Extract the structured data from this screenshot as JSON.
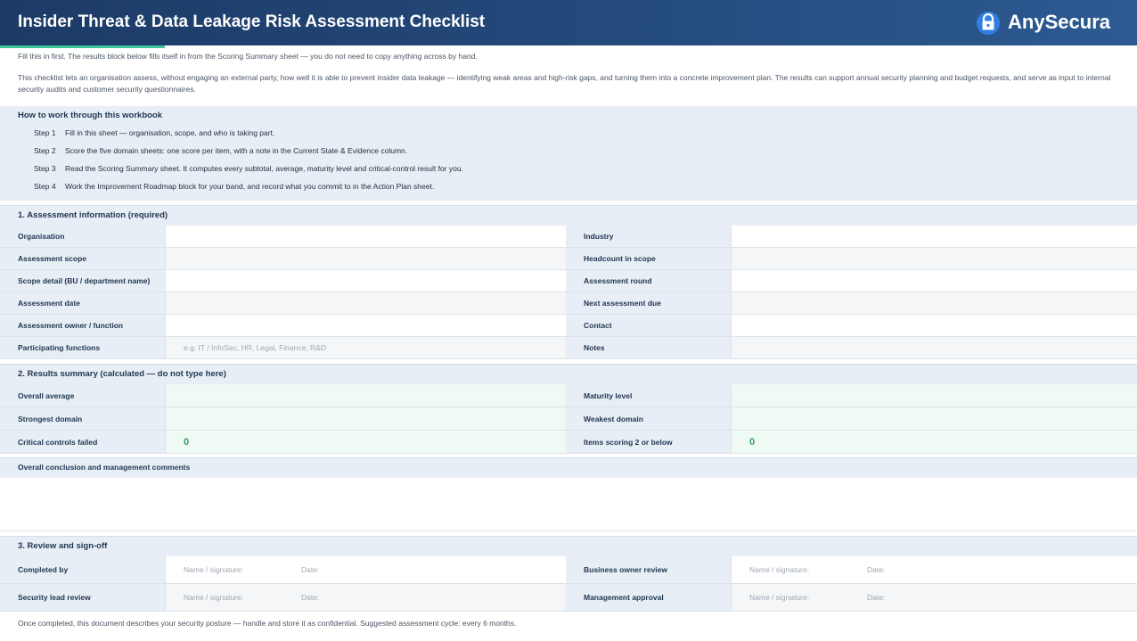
{
  "header": {
    "title": "Insider Threat & Data Leakage Risk Assessment Checklist",
    "brand": "AnySecura",
    "colors": {
      "header_bg": "#1c3a66",
      "accent": "#3fc59a",
      "result_green": "#2e9d6c"
    }
  },
  "intro": {
    "line1": "Fill this in first. The results block below fills itself in from the Scoring Summary sheet — you do not need to copy anything across by hand.",
    "line2": "This checklist lets an organisation assess, without engaging an external party, how well it is able to prevent insider data leakage — identifying weak areas and high-risk gaps, and turning them into a concrete improvement plan. The results can support annual security planning and budget requests, and serve as input to internal security audits and customer security questionnaires."
  },
  "howto": {
    "title": "How to work through this workbook",
    "steps": [
      {
        "num": "Step 1",
        "text": "Fill in this sheet — organisation, scope, and who is taking part."
      },
      {
        "num": "Step 2",
        "text": "Score the five domain sheets: one score per item, with a note in the Current State & Evidence column."
      },
      {
        "num": "Step 3",
        "text": "Read the Scoring Summary sheet. It computes every subtotal, average, maturity level and critical-control result for you."
      },
      {
        "num": "Step 4",
        "text": "Work the Improvement Roadmap block for your band, and record what you commit to in the Action Plan sheet."
      }
    ]
  },
  "section1": {
    "title": "1.  Assessment information  (required)",
    "rows": [
      {
        "l1": "Organisation",
        "v1": "",
        "l2": "Industry",
        "v2": ""
      },
      {
        "l1": "Assessment scope",
        "v1": "",
        "l2": "Headcount in scope",
        "v2": ""
      },
      {
        "l1": "Scope detail (BU / department name)",
        "v1": "",
        "l2": "Assessment round",
        "v2": ""
      },
      {
        "l1": "Assessment date",
        "v1": "",
        "l2": "Next assessment due",
        "v2": ""
      },
      {
        "l1": "Assessment owner / function",
        "v1": "",
        "l2": "Contact",
        "v2": ""
      },
      {
        "l1": "Participating functions",
        "v1": "e.g. IT / InfoSec, HR, Legal, Finance, R&D",
        "l2": "Notes",
        "v2": ""
      }
    ]
  },
  "section2": {
    "title": "2.  Results summary  (calculated — do not type here)",
    "rows": [
      {
        "l1": "Overall average",
        "v1": "",
        "l2": "Maturity level",
        "v2": ""
      },
      {
        "l1": "Strongest domain",
        "v1": "",
        "l2": "Weakest domain",
        "v2": ""
      },
      {
        "l1": "Critical controls failed",
        "v1": "0",
        "l2": "Items scoring 2 or below",
        "v2": "0"
      }
    ],
    "conclusion_label": "Overall conclusion and management comments"
  },
  "section3": {
    "title": "3.  Review and sign-off",
    "name_hint": "Name / signature:",
    "date_hint": "Date:",
    "rows": [
      {
        "l1": "Completed by",
        "l2": "Business owner review"
      },
      {
        "l1": "Security lead review",
        "l2": "Management approval"
      }
    ]
  },
  "footer": "Once completed, this document describes your security posture — handle and store it as confidential. Suggested assessment cycle: every 6 months."
}
